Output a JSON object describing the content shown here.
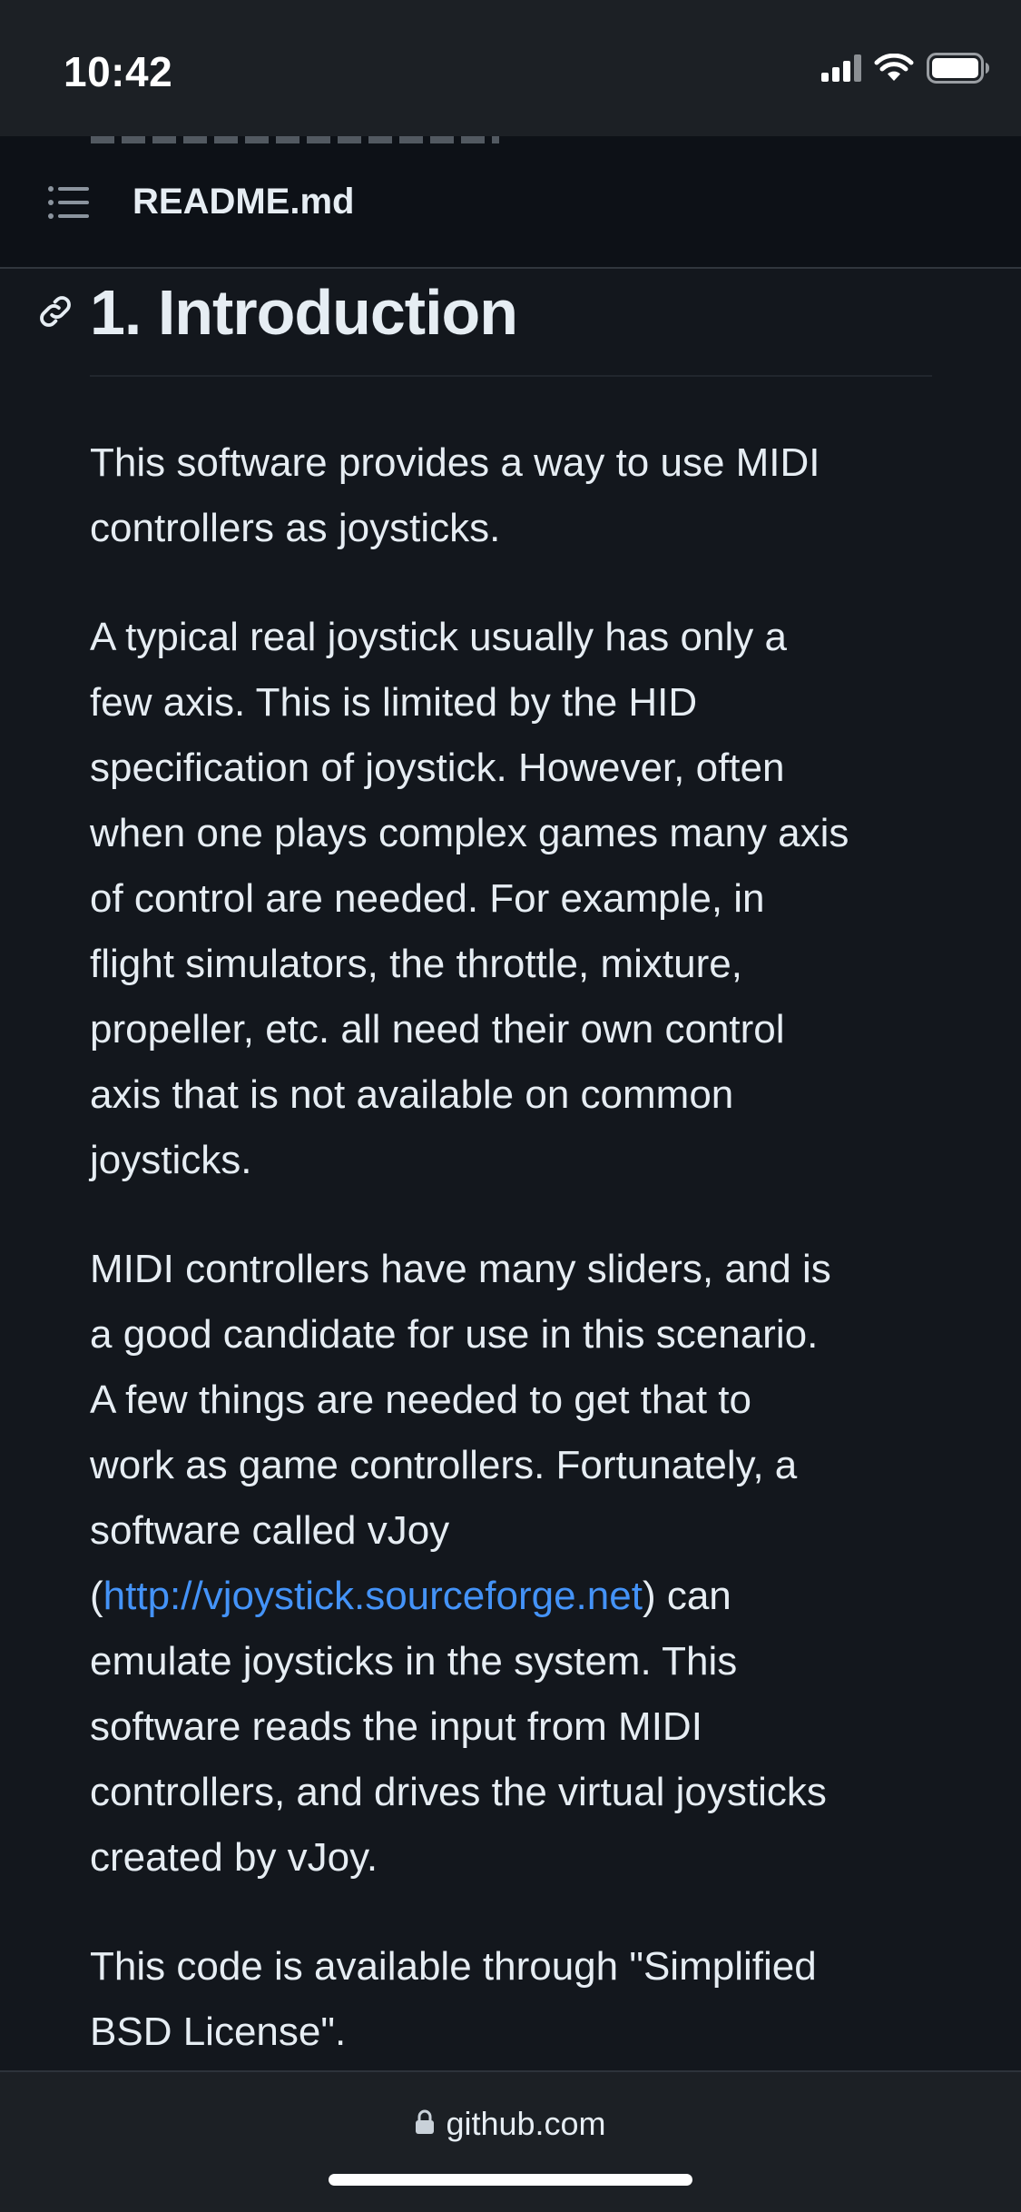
{
  "status_bar": {
    "time": "10:42",
    "icons": [
      "cellular-signal-icon",
      "wifi-icon",
      "battery-icon"
    ]
  },
  "file_header": {
    "toc_icon": "list-icon",
    "title": "README.md"
  },
  "section": {
    "anchor_icon": "link-icon",
    "heading": "1. Introduction"
  },
  "paragraphs": [
    {
      "lines": [
        "This software provides a way to use MIDI",
        "controllers as joysticks."
      ]
    },
    {
      "lines": [
        "A typical real joystick usually has only a",
        "few axis. This is limited by the HID",
        "specification of joystick. However, often",
        "when one plays complex games many axis",
        "of control are needed. For example, in",
        "flight simulators, the throttle, mixture,",
        "propeller, etc. all need their own control",
        "axis that is not available on common",
        "joysticks."
      ]
    },
    {
      "lines_before_link": [
        "MIDI controllers have many sliders, and is",
        "a good candidate for use in this scenario.",
        "A few things are needed to get that to",
        "work as game controllers. Fortunately, a",
        "software called vJoy"
      ],
      "link_line": {
        "prefix": "(",
        "link_text": "http://vjoystick.sourceforge.net",
        "suffix": ") can"
      },
      "lines_after_link": [
        "emulate joysticks in the system. This",
        "software reads the input from MIDI",
        "controllers, and drives the virtual joysticks",
        "created by vJoy."
      ]
    },
    {
      "lines": [
        "This code is available through \"Simplified",
        "BSD License\"."
      ]
    }
  ],
  "url_bar": {
    "lock_icon": "lock-icon",
    "domain": "github.com"
  },
  "colors": {
    "background": "#0d1117",
    "content_background": "#13171d",
    "text": "#e6edf3",
    "link": "#4493f8",
    "bar_background": "#1c2025"
  }
}
